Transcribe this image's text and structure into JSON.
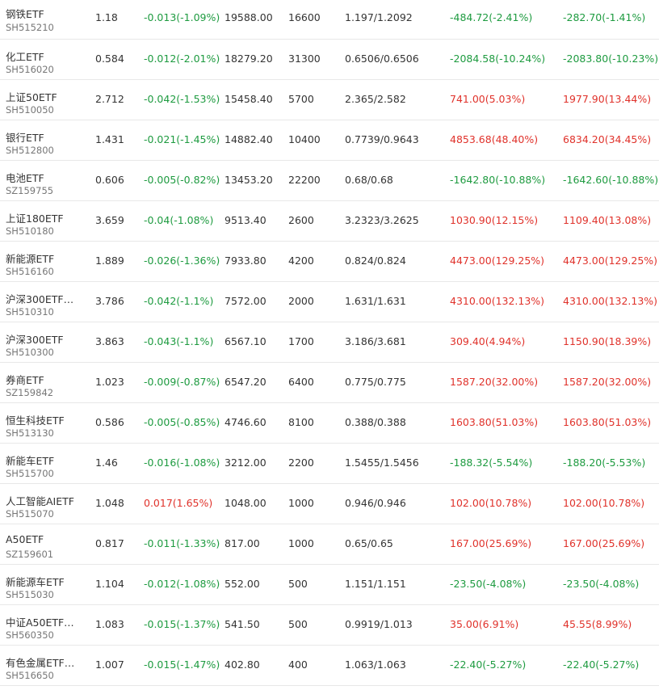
{
  "colors": {
    "up": "#e0322b",
    "down": "#1e9b40",
    "text": "#333333",
    "code": "#777777"
  },
  "rows": [
    {
      "name": "钢铁ETF",
      "code": "SH515210",
      "price": "1.18",
      "change": "-0.013(-1.09%)",
      "market_value": "19588.00",
      "quantity": "16600",
      "cost": "1.197/1.2092",
      "pnl1": "-484.72(-2.41%)",
      "pnl2": "-282.70(-1.41%)"
    },
    {
      "name": "化工ETF",
      "code": "SH516020",
      "price": "0.584",
      "change": "-0.012(-2.01%)",
      "market_value": "18279.20",
      "quantity": "31300",
      "cost": "0.6506/0.6506",
      "pnl1": "-2084.58(-10.24%)",
      "pnl2": "-2083.80(-10.23%)"
    },
    {
      "name": "上证50ETF",
      "code": "SH510050",
      "price": "2.712",
      "change": "-0.042(-1.53%)",
      "market_value": "15458.40",
      "quantity": "5700",
      "cost": "2.365/2.582",
      "pnl1": "741.00(5.03%)",
      "pnl2": "1977.90(13.44%)"
    },
    {
      "name": "银行ETF",
      "code": "SH512800",
      "price": "1.431",
      "change": "-0.021(-1.45%)",
      "market_value": "14882.40",
      "quantity": "10400",
      "cost": "0.7739/0.9643",
      "pnl1": "4853.68(48.40%)",
      "pnl2": "6834.20(34.45%)"
    },
    {
      "name": "电池ETF",
      "code": "SZ159755",
      "price": "0.606",
      "change": "-0.005(-0.82%)",
      "market_value": "13453.20",
      "quantity": "22200",
      "cost": "0.68/0.68",
      "pnl1": "-1642.80(-10.88%)",
      "pnl2": "-1642.60(-10.88%)"
    },
    {
      "name": "上证180ETF",
      "code": "SH510180",
      "price": "3.659",
      "change": "-0.04(-1.08%)",
      "market_value": "9513.40",
      "quantity": "2600",
      "cost": "3.2323/3.2625",
      "pnl1": "1030.90(12.15%)",
      "pnl2": "1109.40(13.08%)"
    },
    {
      "name": "新能源ETF",
      "code": "SH516160",
      "price": "1.889",
      "change": "-0.026(-1.36%)",
      "market_value": "7933.80",
      "quantity": "4200",
      "cost": "0.824/0.824",
      "pnl1": "4473.00(129.25%)",
      "pnl2": "4473.00(129.25%)"
    },
    {
      "name": "沪深300ETF…",
      "code": "SH510310",
      "price": "3.786",
      "change": "-0.042(-1.1%)",
      "market_value": "7572.00",
      "quantity": "2000",
      "cost": "1.631/1.631",
      "pnl1": "4310.00(132.13%)",
      "pnl2": "4310.00(132.13%)"
    },
    {
      "name": "沪深300ETF",
      "code": "SH510300",
      "price": "3.863",
      "change": "-0.043(-1.1%)",
      "market_value": "6567.10",
      "quantity": "1700",
      "cost": "3.186/3.681",
      "pnl1": "309.40(4.94%)",
      "pnl2": "1150.90(18.39%)"
    },
    {
      "name": "券商ETF",
      "code": "SZ159842",
      "price": "1.023",
      "change": "-0.009(-0.87%)",
      "market_value": "6547.20",
      "quantity": "6400",
      "cost": "0.775/0.775",
      "pnl1": "1587.20(32.00%)",
      "pnl2": "1587.20(32.00%)"
    },
    {
      "name": "恒生科技ETF",
      "code": "SH513130",
      "price": "0.586",
      "change": "-0.005(-0.85%)",
      "market_value": "4746.60",
      "quantity": "8100",
      "cost": "0.388/0.388",
      "pnl1": "1603.80(51.03%)",
      "pnl2": "1603.80(51.03%)"
    },
    {
      "name": "新能车ETF",
      "code": "SH515700",
      "price": "1.46",
      "change": "-0.016(-1.08%)",
      "market_value": "3212.00",
      "quantity": "2200",
      "cost": "1.5455/1.5456",
      "pnl1": "-188.32(-5.54%)",
      "pnl2": "-188.20(-5.53%)"
    },
    {
      "name": "人工智能AIETF",
      "code": "SH515070",
      "price": "1.048",
      "change": "0.017(1.65%)",
      "market_value": "1048.00",
      "quantity": "1000",
      "cost": "0.946/0.946",
      "pnl1": "102.00(10.78%)",
      "pnl2": "102.00(10.78%)"
    },
    {
      "name": "A50ETF",
      "code": "SZ159601",
      "price": "0.817",
      "change": "-0.011(-1.33%)",
      "market_value": "817.00",
      "quantity": "1000",
      "cost": "0.65/0.65",
      "pnl1": "167.00(25.69%)",
      "pnl2": "167.00(25.69%)"
    },
    {
      "name": "新能源车ETF",
      "code": "SH515030",
      "price": "1.104",
      "change": "-0.012(-1.08%)",
      "market_value": "552.00",
      "quantity": "500",
      "cost": "1.151/1.151",
      "pnl1": "-23.50(-4.08%)",
      "pnl2": "-23.50(-4.08%)"
    },
    {
      "name": "中证A50ETF…",
      "code": "SH560350",
      "price": "1.083",
      "change": "-0.015(-1.37%)",
      "market_value": "541.50",
      "quantity": "500",
      "cost": "0.9919/1.013",
      "pnl1": "35.00(6.91%)",
      "pnl2": "45.55(8.99%)"
    },
    {
      "name": "有色金属ETF…",
      "code": "SH516650",
      "price": "1.007",
      "change": "-0.015(-1.47%)",
      "market_value": "402.80",
      "quantity": "400",
      "cost": "1.063/1.063",
      "pnl1": "-22.40(-5.27%)",
      "pnl2": "-22.40(-5.27%)"
    }
  ]
}
